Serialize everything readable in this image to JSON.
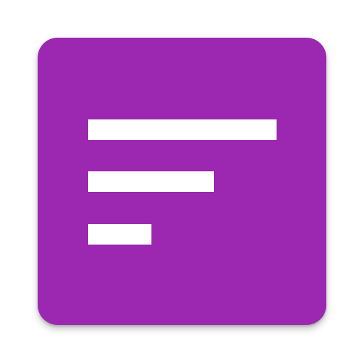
{
  "icon": {
    "name": "sort-lines-icon",
    "background_color": "#9C27B0",
    "foreground_color": "#FFFFFF"
  }
}
